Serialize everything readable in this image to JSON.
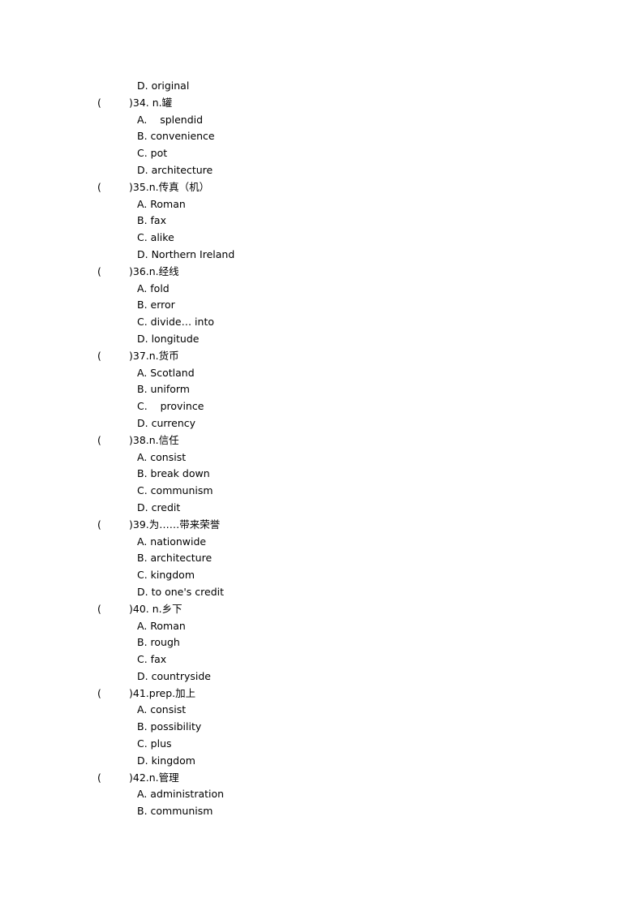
{
  "document": {
    "leading_options": [
      {
        "label": "D. original"
      }
    ],
    "questions": [
      {
        "number": "34",
        "prompt": ")34. n.罐",
        "options": [
          "A.    splendid",
          "B. convenience",
          "C. pot",
          "D. architecture"
        ]
      },
      {
        "number": "35",
        "prompt": ")35.n.传真（机）",
        "options": [
          "A. Roman",
          "B. fax",
          "C. alike",
          "D. Northern Ireland"
        ]
      },
      {
        "number": "36",
        "prompt": ")36.n.经线",
        "options": [
          "A. fold",
          "B. error",
          "C. divide… into",
          "D. longitude"
        ]
      },
      {
        "number": "37",
        "prompt": ")37.n.货币",
        "options": [
          "A. Scotland",
          "B. uniform",
          "C.    province",
          "D. currency"
        ]
      },
      {
        "number": "38",
        "prompt": ")38.n.信任",
        "options": [
          "A. consist",
          "B. break down",
          "C. communism",
          "D. credit"
        ]
      },
      {
        "number": "39",
        "prompt": ")39.为……带来荣誉",
        "options": [
          "A. nationwide",
          "B. architecture",
          "C. kingdom",
          "D. to one's credit"
        ]
      },
      {
        "number": "40",
        "prompt": ")40. n.乡下",
        "options": [
          "A. Roman",
          "B. rough",
          "C. fax",
          "D. countryside"
        ]
      },
      {
        "number": "41",
        "prompt": ")41.prep.加上",
        "options": [
          "A. consist",
          "B. possibility",
          "C. plus",
          "D. kingdom"
        ]
      },
      {
        "number": "42",
        "prompt": ")42.n.管理",
        "options": [
          "A. administration",
          "B. communism"
        ]
      }
    ],
    "paren_open": "("
  }
}
